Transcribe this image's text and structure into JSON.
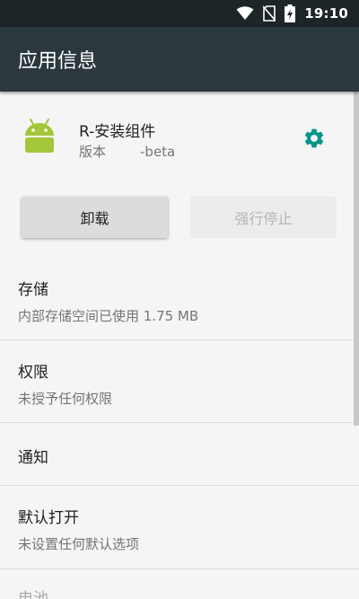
{
  "status_bar": {
    "time": "19:10",
    "icons": [
      "wifi-icon",
      "no-sim-icon",
      "battery-charging-icon"
    ]
  },
  "app_bar": {
    "title": "应用信息"
  },
  "app": {
    "name": "R-安装组件",
    "version_prefix": "版本",
    "version_suffix": "-beta",
    "icon": "android-icon"
  },
  "buttons": {
    "uninstall": "卸载",
    "force_stop": "强行停止"
  },
  "sections": {
    "storage": {
      "title": "存储",
      "subtitle": "内部存储空间已使用 1.75 MB"
    },
    "permissions": {
      "title": "权限",
      "subtitle": "未授予任何权限"
    },
    "notifications": {
      "title": "通知"
    },
    "open_by_default": {
      "title": "默认打开",
      "subtitle": "未设置任何默认选项"
    },
    "battery": {
      "title": "电池"
    }
  },
  "colors": {
    "status_bar": "#1d2529",
    "app_bar": "#2b383d",
    "accent": "#009688",
    "android_green": "#a4c639"
  }
}
